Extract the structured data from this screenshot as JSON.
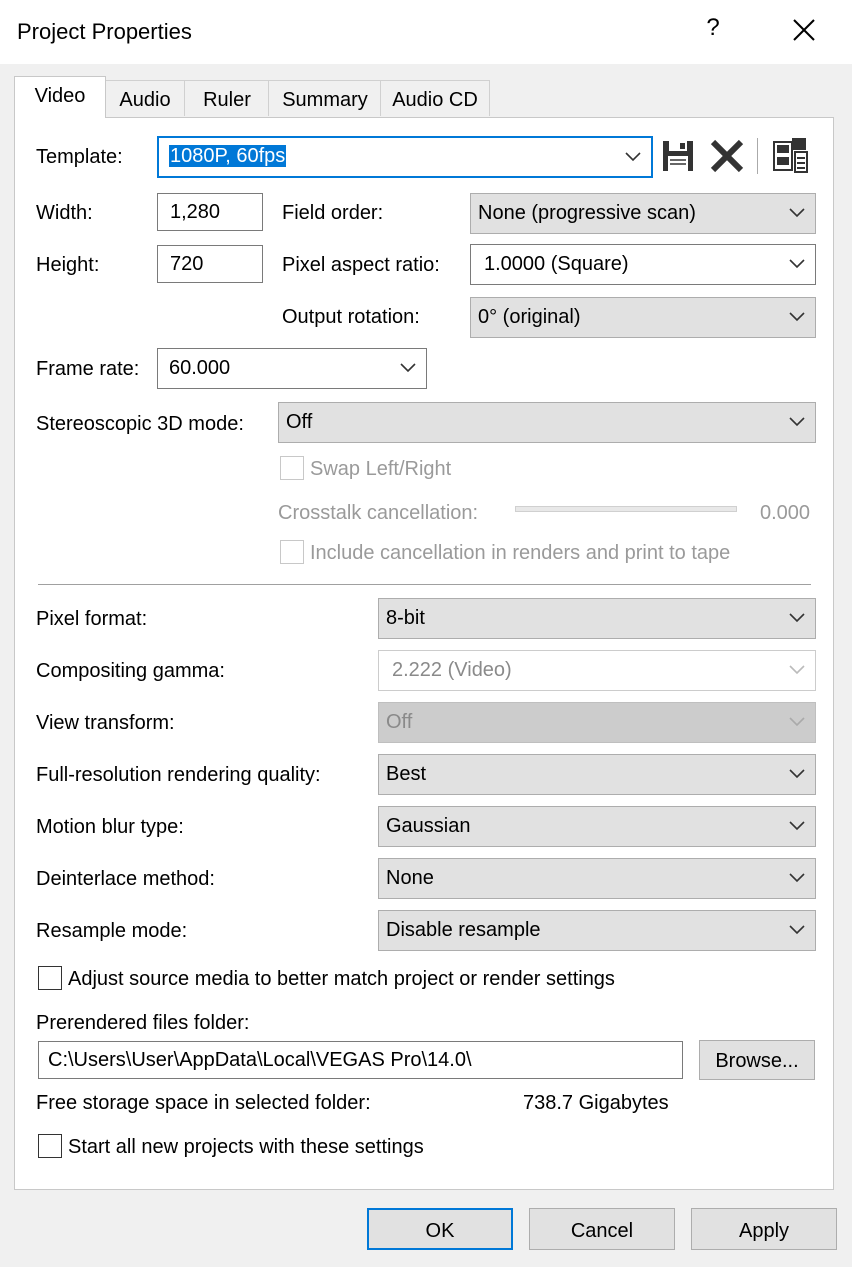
{
  "window": {
    "title": "Project Properties",
    "help": "?"
  },
  "tabs": [
    {
      "label": "Video"
    },
    {
      "label": "Audio"
    },
    {
      "label": "Ruler"
    },
    {
      "label": "Summary"
    },
    {
      "label": "Audio CD"
    }
  ],
  "video": {
    "template_label": "Template:",
    "template_value": "1080P, 60fps",
    "width_label": "Width:",
    "width_value": "1,280",
    "height_label": "Height:",
    "height_value": "720",
    "field_order_label": "Field order:",
    "field_order_value": "None (progressive scan)",
    "pixel_aspect_label": "Pixel aspect ratio:",
    "pixel_aspect_value": "1.0000 (Square)",
    "output_rotation_label": "Output rotation:",
    "output_rotation_value": "0° (original)",
    "frame_rate_label": "Frame rate:",
    "frame_rate_value": "60.000",
    "stereo_label": "Stereoscopic 3D mode:",
    "stereo_value": "Off",
    "swap_label": "Swap Left/Right",
    "crosstalk_label": "Crosstalk cancellation:",
    "crosstalk_value": "0.000",
    "include_cancel_label": "Include cancellation in renders and print to tape",
    "pixel_format_label": "Pixel format:",
    "pixel_format_value": "8-bit",
    "gamma_label": "Compositing gamma:",
    "gamma_value": "2.222 (Video)",
    "view_transform_label": "View transform:",
    "view_transform_value": "Off",
    "render_quality_label": "Full-resolution rendering quality:",
    "render_quality_value": "Best",
    "motion_blur_label": "Motion blur type:",
    "motion_blur_value": "Gaussian",
    "deinterlace_label": "Deinterlace method:",
    "deinterlace_value": "None",
    "resample_label": "Resample mode:",
    "resample_value": "Disable resample",
    "adjust_source_label": "Adjust source media to better match project or render settings",
    "prerender_label": "Prerendered files folder:",
    "prerender_path": "C:\\Users\\User\\AppData\\Local\\VEGAS Pro\\14.0\\",
    "browse_label": "Browse...",
    "free_space_label": "Free storage space in selected folder:",
    "free_space_value": "738.7 Gigabytes",
    "start_all_label": "Start all new projects with these settings"
  },
  "footer": {
    "ok": "OK",
    "cancel": "Cancel",
    "apply": "Apply"
  },
  "colors": {
    "accent": "#0078d7",
    "disabled_text": "#9a9a9a"
  }
}
